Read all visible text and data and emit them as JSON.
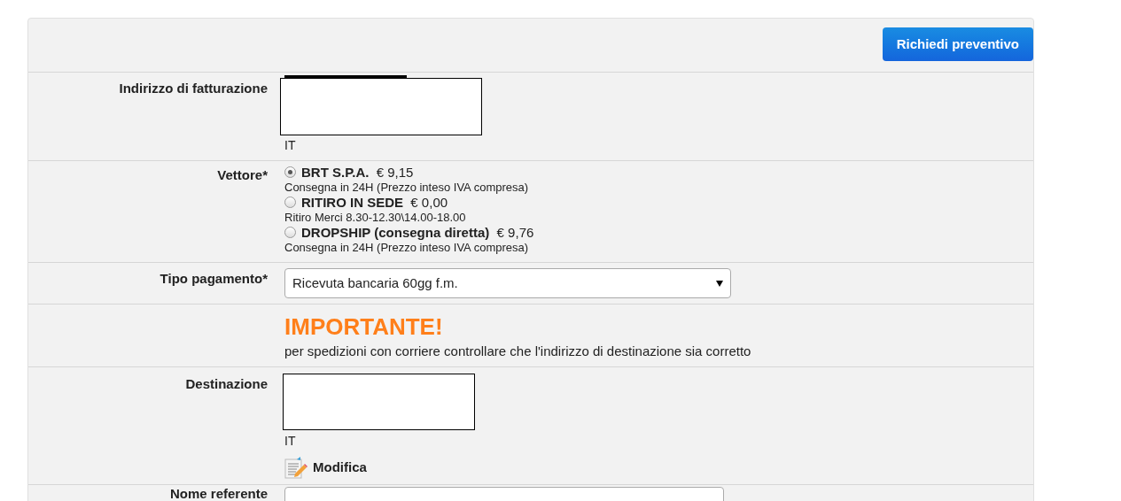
{
  "header": {
    "button": "Richiedi preventivo"
  },
  "billing": {
    "label": "Indirizzo di fatturazione",
    "country": "IT"
  },
  "carrier": {
    "label": "Vettore*",
    "options": [
      {
        "name": "BRT S.P.A.",
        "price": "€ 9,15",
        "note": "Consegna in 24H (Prezzo inteso IVA compresa)",
        "selected": true
      },
      {
        "name": "RITIRO IN SEDE",
        "price": "€ 0,00",
        "note": "Ritiro Merci 8.30-12.30\\14.00-18.00",
        "selected": false
      },
      {
        "name": "DROPSHIP (consegna diretta)",
        "price": "€ 9,76",
        "note": "Consegna in 24H (Prezzo inteso IVA compresa)",
        "selected": false
      }
    ]
  },
  "payment": {
    "label": "Tipo pagamento*",
    "value": "Ricevuta bancaria 60gg f.m."
  },
  "notice": {
    "title": "IMPORTANTE!",
    "text": "per spedizioni con corriere controllare che l'indirizzo di destinazione sia corretto"
  },
  "destination": {
    "label": "Destinazione",
    "country": "IT",
    "edit": "Modifica"
  },
  "contact": {
    "label": "Nome referente"
  }
}
